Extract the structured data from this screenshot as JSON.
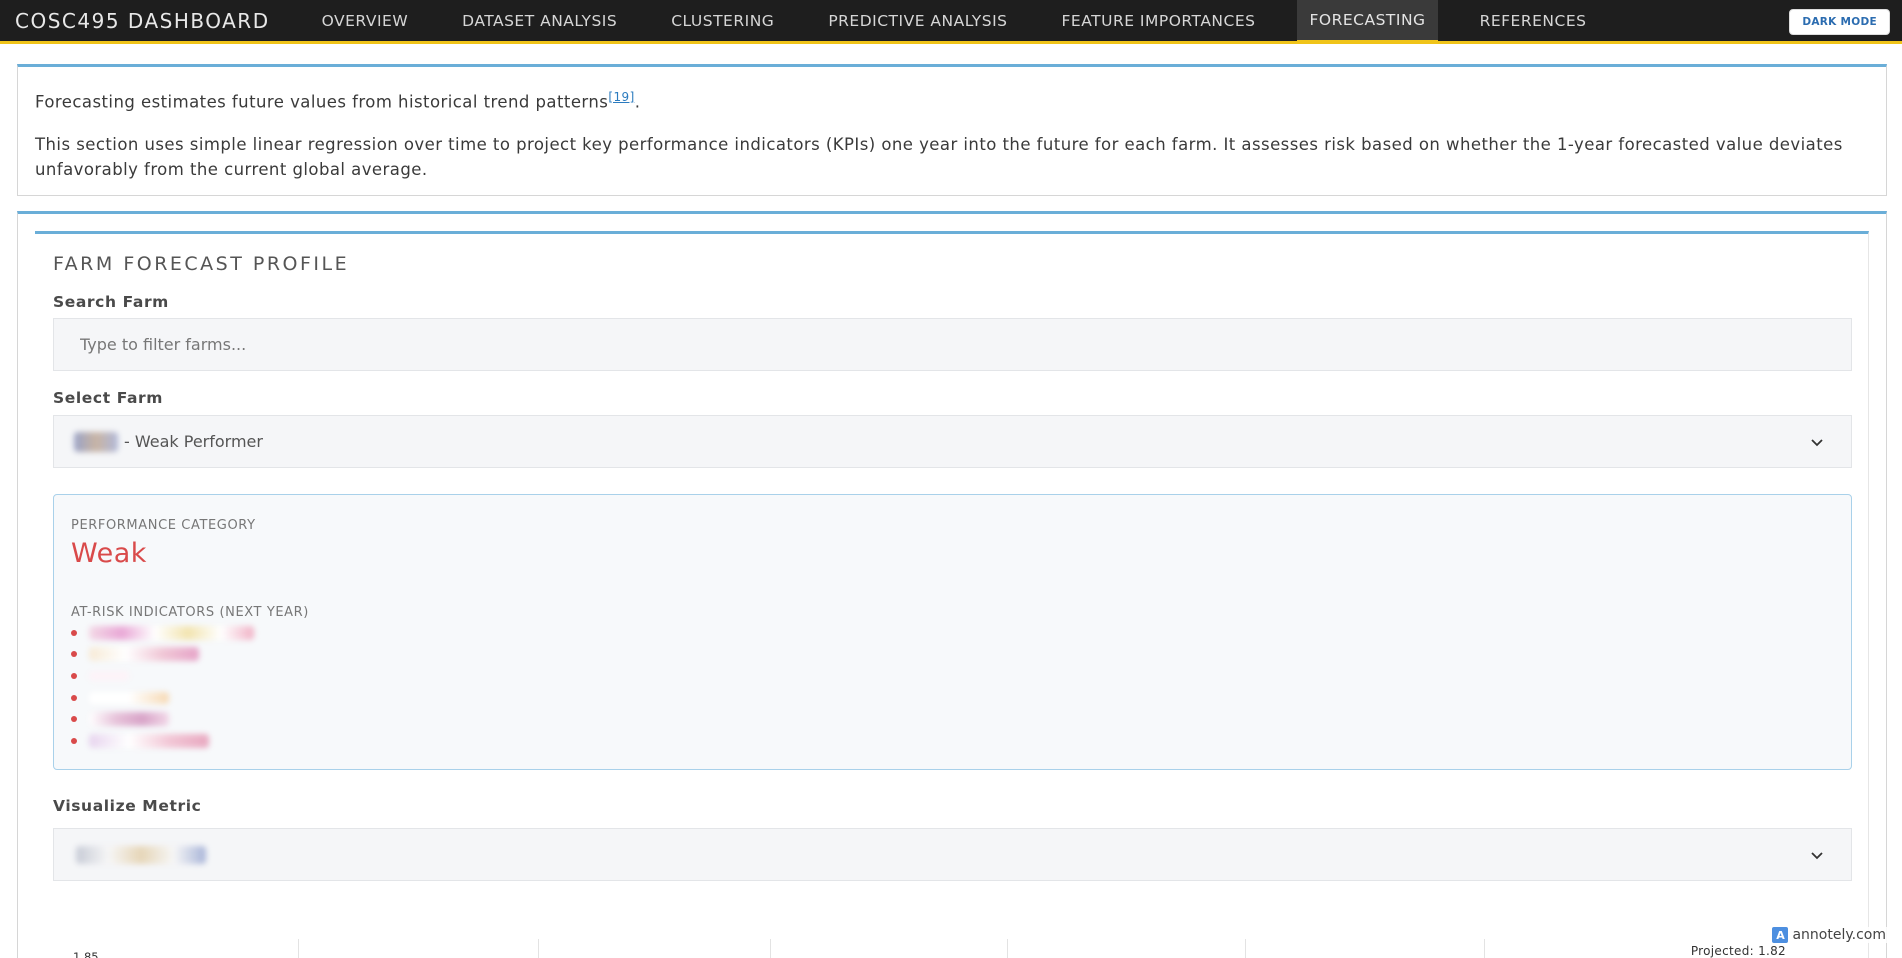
{
  "navbar": {
    "brand": "COSC495 DASHBOARD",
    "items": [
      {
        "label": "OVERVIEW",
        "active": false
      },
      {
        "label": "DATASET ANALYSIS",
        "active": false
      },
      {
        "label": "CLUSTERING",
        "active": false
      },
      {
        "label": "PREDICTIVE ANALYSIS",
        "active": false
      },
      {
        "label": "FEATURE IMPORTANCES",
        "active": false
      },
      {
        "label": "FORECASTING",
        "active": true
      },
      {
        "label": "REFERENCES",
        "active": false
      }
    ],
    "dark_mode_label": "DARK MODE",
    "accent_color": "#f0c419"
  },
  "intro": {
    "line1": "Forecasting estimates future values from historical trend patterns",
    "citation": "[19]",
    "line1_end": ".",
    "line2": "This section uses simple linear regression over time to project key performance indicators (KPIs) one year into the future for each farm. It assesses risk based on whether the 1-year forecasted value deviates unfavorably from the current global average."
  },
  "profile": {
    "title": "FARM FORECAST PROFILE",
    "search_label": "Search Farm",
    "search_placeholder": "Type to filter farms...",
    "search_value": "",
    "select_label": "Select Farm",
    "select_value_suffix": "- Weak Performer",
    "category_label": "PERFORMANCE CATEGORY",
    "category_value": "Weak",
    "category_color": "#d94a4a",
    "risk_label": "AT-RISK INDICATORS (NEXT YEAR)",
    "risk_item_count_redacted": 6,
    "metric_label": "Visualize Metric"
  },
  "chart_peek": {
    "y_tick_top": "1.85",
    "projected_label": "Projected: 1.82"
  },
  "watermark": "annotely.com"
}
